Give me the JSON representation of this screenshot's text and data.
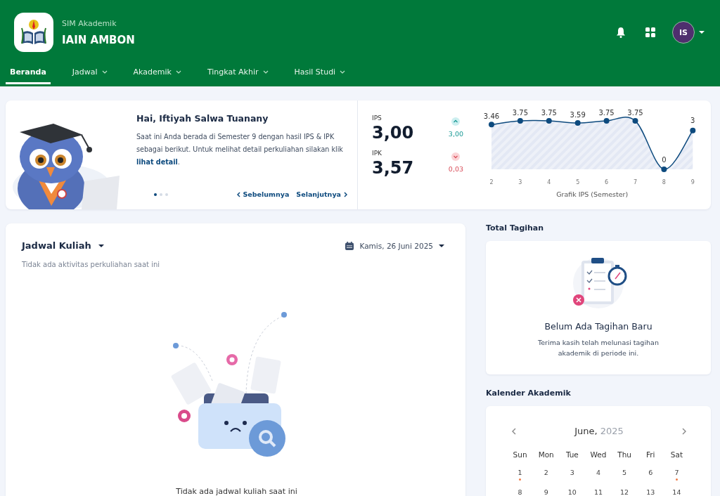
{
  "header": {
    "subtitle": "SIM Akademik",
    "title": "IAIN AMBON",
    "avatar": "IS"
  },
  "nav": [
    {
      "label": "Beranda",
      "selected": true,
      "dropdown": false
    },
    {
      "label": "Jadwal",
      "selected": false,
      "dropdown": true
    },
    {
      "label": "Akademik",
      "selected": false,
      "dropdown": true
    },
    {
      "label": "Tingkat Akhir",
      "selected": false,
      "dropdown": true
    },
    {
      "label": "Hasil Studi",
      "selected": false,
      "dropdown": true
    }
  ],
  "welcome": {
    "title": "Hai, Iftiyah Salwa Tuanany",
    "text": "Saat ini Anda berada di Semester 9 dengan hasil IPS & IPK sebagai berikut. Untuk melihat detail perkuliahan silakan klik",
    "link": "lihat detail",
    "after": ".",
    "dots": [
      {
        "selected": true
      },
      {
        "selected": false
      },
      {
        "selected": false
      }
    ],
    "prev": "Sebelumnya",
    "next": "Selanjutnya"
  },
  "stats": [
    {
      "label": "IPS",
      "value": "3,00",
      "kind": "up",
      "change": "3,00"
    },
    {
      "label": "IPK",
      "value": "3,57",
      "kind": "down",
      "change": "0,03"
    }
  ],
  "chart_data": {
    "type": "area",
    "xlabel": "Grafik IPS (Semester)",
    "categories": [
      "2",
      "3",
      "4",
      "5",
      "6",
      "7",
      "8",
      "9"
    ],
    "series": [
      {
        "color": "#0d4a7e",
        "marker": "circle",
        "values": [
          3.46,
          3.75,
          3.75,
          3.59,
          3.75,
          3.75,
          0,
          3
        ]
      }
    ],
    "data_labels": true
  },
  "schedule": {
    "title": "Jadwal Kuliah",
    "date": "Kamis, 26 Juni 2025",
    "subtitle": "Tidak ada aktivitas perkuliahan saat ini",
    "empty": "Tidak ada jadwal kuliah saat ini"
  },
  "bills": {
    "heading": "Total Tagihan",
    "title": "Belum Ada Tagihan Baru",
    "text": "Terima kasih telah melunasi tagihan akademik di periode ini."
  },
  "calendar": {
    "heading": "Kalender Akademik",
    "month": "June,",
    "year": "2025",
    "weekdays": [
      "Sun",
      "Mon",
      "Tue",
      "Wed",
      "Thu",
      "Fri",
      "Sat"
    ],
    "weeks": [
      [
        {
          "day": "1",
          "event": true
        },
        {
          "day": "2",
          "event": false
        },
        {
          "day": "3",
          "event": false
        },
        {
          "day": "4",
          "event": false
        },
        {
          "day": "5",
          "event": false
        },
        {
          "day": "6",
          "event": false
        },
        {
          "day": "7",
          "event": true
        }
      ],
      [
        {
          "day": "8",
          "event": false
        },
        {
          "day": "9",
          "event": false
        },
        {
          "day": "10",
          "event": false
        },
        {
          "day": "11",
          "event": false
        },
        {
          "day": "12",
          "event": false
        },
        {
          "day": "13",
          "event": false
        },
        {
          "day": "14",
          "event": false
        }
      ]
    ]
  }
}
